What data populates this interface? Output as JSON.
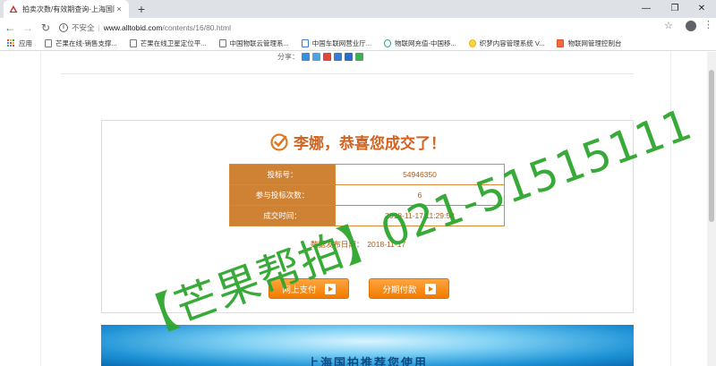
{
  "browser": {
    "tab_title": "拍卖次数/有效期查询-上海国际...",
    "tab_close": "×",
    "new_tab": "+",
    "window_controls": [
      "—",
      "❐",
      "✕"
    ],
    "insecure_label": "不安全",
    "separator": "|",
    "url_host": "www.alltobid.com",
    "url_path": "/contents/16/80.html",
    "star_icon": "☆",
    "menu_icon": "⋮"
  },
  "bookmarks": [
    {
      "label": "应用",
      "icon": "apps-icon"
    },
    {
      "label": "芒果在线-销售支撑...",
      "icon": "page-icon"
    },
    {
      "label": "芒果在线卫星定位平...",
      "icon": "page-icon"
    },
    {
      "label": "中国物联云管理系...",
      "icon": "page-icon"
    },
    {
      "label": "中国车联网营业厅...",
      "icon": "page-icon"
    },
    {
      "label": "物联网充值-中国移...",
      "icon": "page-icon"
    },
    {
      "label": "织梦内容管理系统 V...",
      "icon": "page-icon"
    },
    {
      "label": "物联网管理控制台",
      "icon": "page-icon"
    }
  ],
  "share": {
    "label": "分享："
  },
  "result": {
    "congrats_text": "李娜，恭喜您成交了！",
    "rows": [
      {
        "key": "投标号：",
        "value": "54946350"
      },
      {
        "key": "参与投标次数：",
        "value": "6"
      },
      {
        "key": "成交时间：",
        "value": "2018-11-17 11:29:58"
      }
    ],
    "publish_label": "数据发布日期：",
    "publish_date": "2018-11-17",
    "pay_online_label": "网上支付",
    "pay_installment_label": "分期付款"
  },
  "banner": {
    "text": "上海国拍推荐您使用"
  },
  "watermark": {
    "text": "【芒果帮拍】021-51515111"
  },
  "colors": {
    "accent_orange": "#d4621f",
    "table_header": "#cf8233",
    "button_orange": "#f07b00",
    "watermark_green": "#2ea62e"
  }
}
